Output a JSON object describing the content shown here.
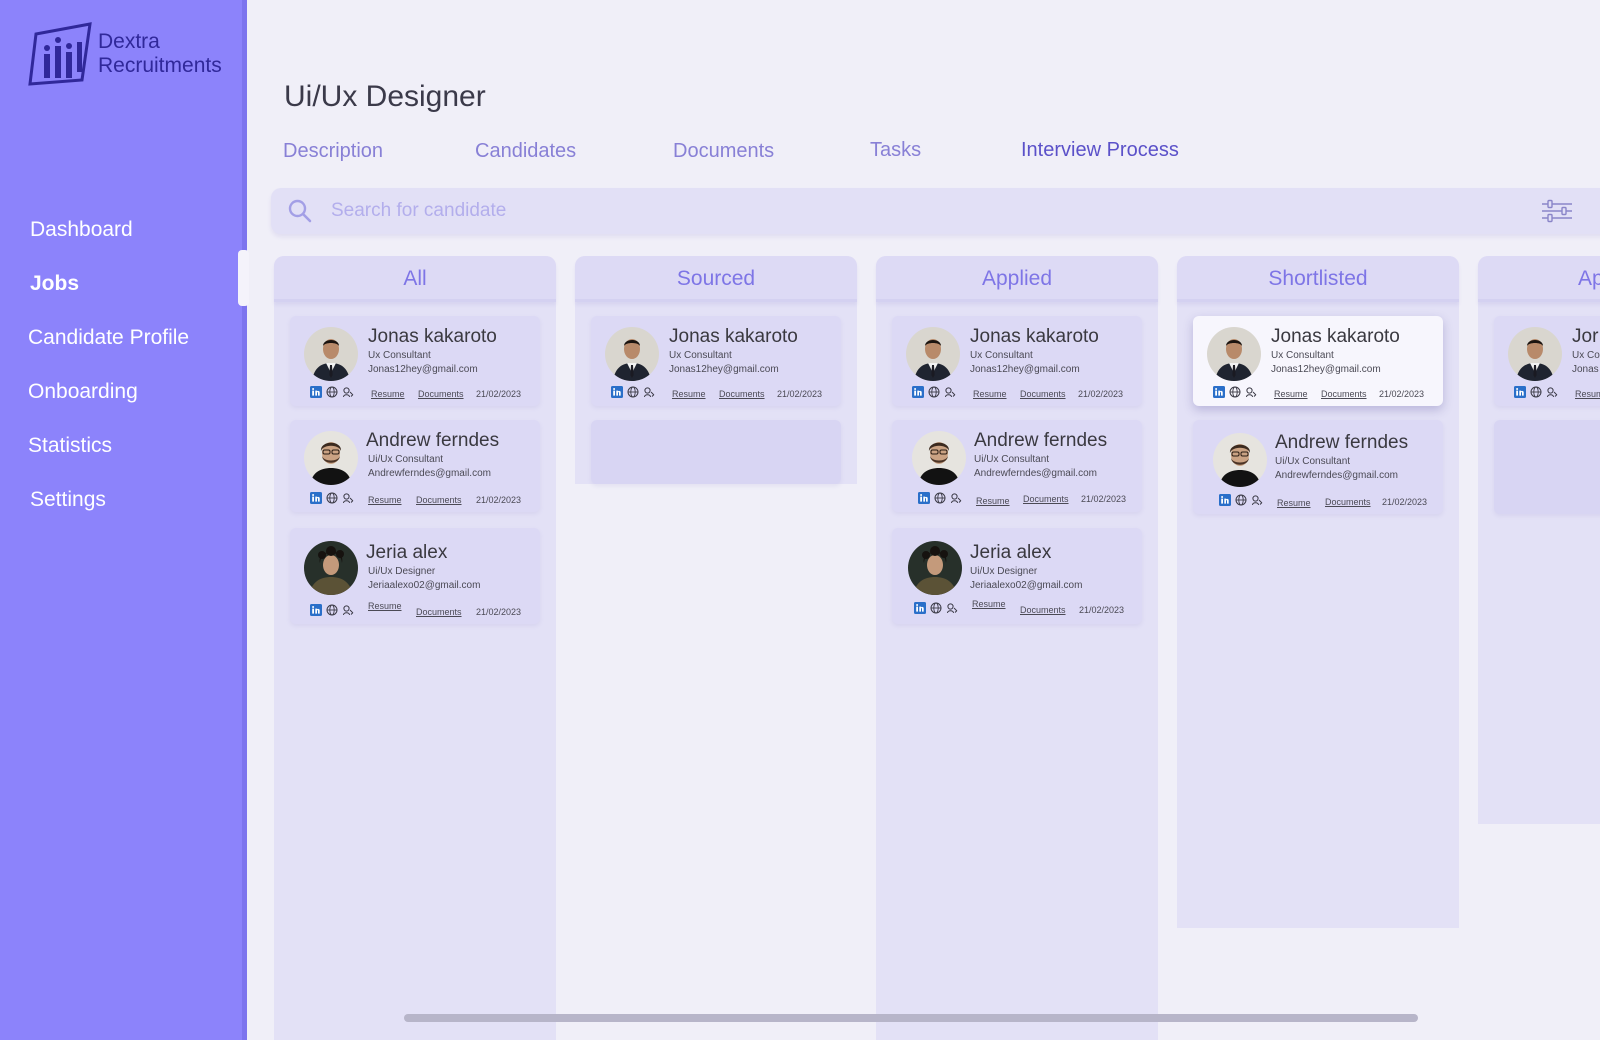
{
  "brand": {
    "line1": "Dextra",
    "line2": "Recruitments"
  },
  "sidebar": {
    "items": [
      {
        "label": "Dashboard"
      },
      {
        "label": "Jobs"
      },
      {
        "label": "Candidate Profile"
      },
      {
        "label": "Onboarding"
      },
      {
        "label": "Statistics"
      },
      {
        "label": "Settings"
      }
    ],
    "active": "Jobs"
  },
  "page": {
    "title": "Ui/Ux Designer"
  },
  "tabs": [
    {
      "label": "Description"
    },
    {
      "label": "Candidates"
    },
    {
      "label": "Documents"
    },
    {
      "label": "Tasks"
    },
    {
      "label": "Interview Process"
    }
  ],
  "active_tab": "Interview Process",
  "search": {
    "placeholder": "Search for candidate"
  },
  "columns": [
    {
      "title": "All"
    },
    {
      "title": "Sourced"
    },
    {
      "title": "Applied"
    },
    {
      "title": "Shortlisted"
    },
    {
      "title": "Ap"
    }
  ],
  "candidates": {
    "jonas": {
      "name": "Jonas kakaroto",
      "role": "Ux Consultant",
      "email": "Jonas12hey@gmail.com"
    },
    "andrew": {
      "name": "Andrew ferndes",
      "role": "Ui/Ux Consultant",
      "email": "Andrewferndes@gmail.com"
    },
    "jeria": {
      "name": "Jeria alex",
      "role": "Ui/Ux Designer",
      "email": "Jeriaalexo02@gmail.com"
    }
  },
  "partial": {
    "name": "Jor",
    "role": "Ux Co",
    "email": "Jonas",
    "resume": "Resum"
  },
  "card_links": {
    "resume": "Resume",
    "documents": "Documents"
  },
  "card_date": "21/02/2023",
  "colors": {
    "sidebar": "#8c83fb",
    "accent": "#7e75e6",
    "card": "#dcd9f5",
    "column": "#e3e1f6",
    "page": "#f0eff8"
  }
}
